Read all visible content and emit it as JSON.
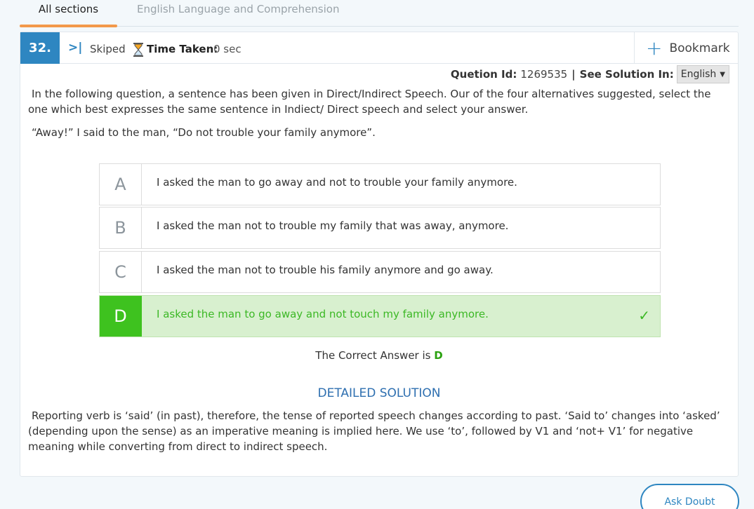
{
  "tabs": [
    {
      "label": "All sections",
      "active": true
    },
    {
      "label": "English Language and Comprehension",
      "active": false
    }
  ],
  "question": {
    "number": "32.",
    "status": "Skiped",
    "time_label": "Time Taken:",
    "time_value": "0 sec",
    "bookmark_label": "Bookmark",
    "id_label": "Quetion Id:",
    "id_value": "1269535",
    "separator": "|",
    "solution_lang_label": "See Solution In:",
    "solution_lang_value": "English",
    "instruction": "In the following question, a sentence has been given in Direct/Indirect Speech. Our of the four alternatives suggested, select the one which best expresses the same sentence in Indiect/ Direct speech and select your answer.",
    "sentence": "“Away!” I said to the man, “Do not trouble your family anymore”."
  },
  "options": [
    {
      "letter": "A",
      "text": "I asked the man to go away and not to trouble your family anymore.",
      "correct": false
    },
    {
      "letter": "B",
      "text": "I asked the man not to trouble my family that was away, anymore.",
      "correct": false
    },
    {
      "letter": "C",
      "text": "I asked the man not to trouble his family anymore and go away.",
      "correct": false
    },
    {
      "letter": "D",
      "text": "I asked the man to go away and not touch my family anymore.",
      "correct": true
    }
  ],
  "answer": {
    "prefix": "The Correct Answer is",
    "value": "D"
  },
  "solution": {
    "title": "DETAILED SOLUTION",
    "text": "Reporting verb is ‘said’ (in past), therefore, the tense of reported speech changes according to past. ‘Said to’ changes into ‘asked’ (depending upon the sense) as an imperative meaning is implied here. We use ‘to’, followed by V1 and ‘not+ V1’ for negative meaning while converting from direct to indirect speech."
  },
  "ask_doubt_label": "Ask Doubt",
  "colors": {
    "accent": "#2e86c1",
    "correct": "#3ec21f",
    "tab_underline": "#f2994a"
  },
  "icons": {
    "skip": "skip-forward-icon",
    "timer": "hourglass-icon",
    "bookmark": "plus-icon",
    "correct": "check-icon",
    "dropdown": "caret-down-icon"
  }
}
